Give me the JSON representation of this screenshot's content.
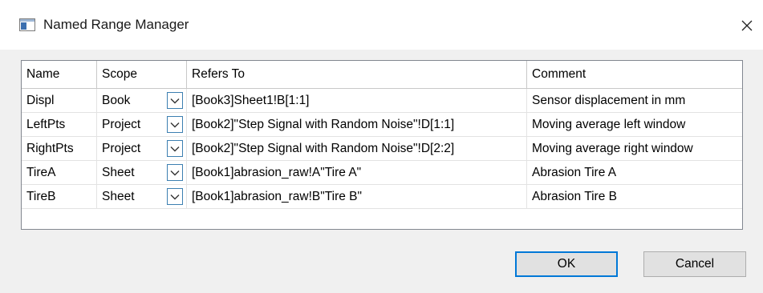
{
  "window": {
    "title": "Named Range Manager",
    "close_glyph": "close-icon"
  },
  "table": {
    "headers": {
      "name": "Name",
      "scope": "Scope",
      "refers_to": "Refers To",
      "comment": "Comment"
    },
    "rows": [
      {
        "name": "Displ",
        "scope": "Book",
        "refers_to": "[Book3]Sheet1!B[1:1]",
        "comment": "Sensor displacement in mm"
      },
      {
        "name": "LeftPts",
        "scope": "Project",
        "refers_to": "[Book2]\"Step Signal with Random Noise\"!D[1:1]",
        "comment": "Moving average left window"
      },
      {
        "name": "RightPts",
        "scope": "Project",
        "refers_to": "[Book2]\"Step Signal with Random Noise\"!D[2:2]",
        "comment": "Moving average right window"
      },
      {
        "name": "TireA",
        "scope": "Sheet",
        "refers_to": "[Book1]abrasion_raw!A\"Tire A\"",
        "comment": "Abrasion Tire A"
      },
      {
        "name": "TireB",
        "scope": "Sheet",
        "refers_to": "[Book1]abrasion_raw!B\"Tire B\"",
        "comment": "Abrasion Tire B"
      }
    ]
  },
  "buttons": {
    "ok": "OK",
    "cancel": "Cancel"
  },
  "colors": {
    "accent": "#0078d7",
    "dropdown_border": "#3c7fb1",
    "grid_border": "#828790"
  }
}
